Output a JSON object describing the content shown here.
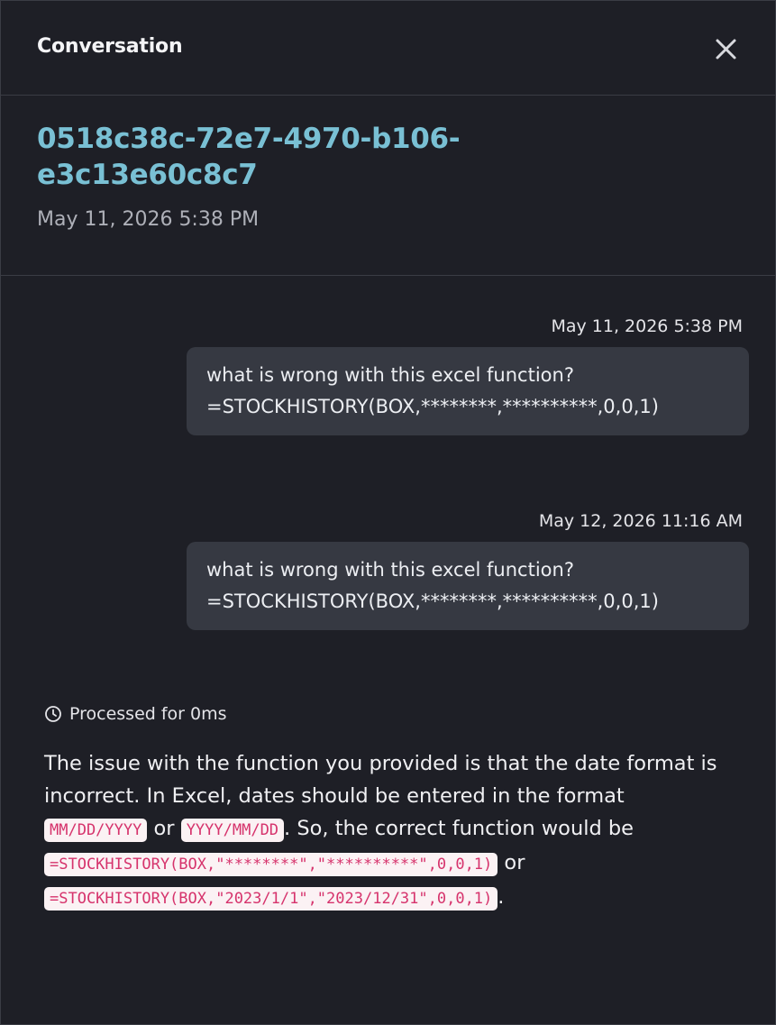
{
  "header": {
    "title": "Conversation",
    "close_icon": "close-icon"
  },
  "conversation": {
    "id": "0518c38c-72e7-4970-b106-e3c13e60c8c7",
    "date": "May 11, 2026 5:38 PM"
  },
  "messages": [
    {
      "time": "May 11, 2026 5:38 PM",
      "line1": "what is wrong with this excel function?",
      "line2": "=STOCKHISTORY(BOX,********,**********,0,0,1)"
    },
    {
      "time": "May 12, 2026 11:16 AM",
      "line1": "what is wrong with this excel function?",
      "line2": "=STOCKHISTORY(BOX,********,**********,0,0,1)"
    }
  ],
  "response": {
    "processed_icon": "clock-icon",
    "processed_label": "Processed for 0ms",
    "text_1": "The issue with the function you provided is that the date format is incorrect. In Excel, dates should be entered in the format ",
    "code_1": "MM/DD/YYYY",
    "text_2": " or ",
    "code_2": "YYYY/MM/DD",
    "text_3": ". So, the correct function would be ",
    "code_3": "=STOCKHISTORY(BOX,\"********\",\"**********\",0,0,1)",
    "text_4": " or ",
    "code_4": "=STOCKHISTORY(BOX,\"2023/1/1\",\"2023/12/31\",0,0,1)",
    "text_5": "."
  },
  "colors": {
    "background": "#1e1f26",
    "accent_id": "#79c0d4",
    "bubble": "#363942",
    "code_text": "#d6336c",
    "code_bg": "#fbf2f4"
  }
}
